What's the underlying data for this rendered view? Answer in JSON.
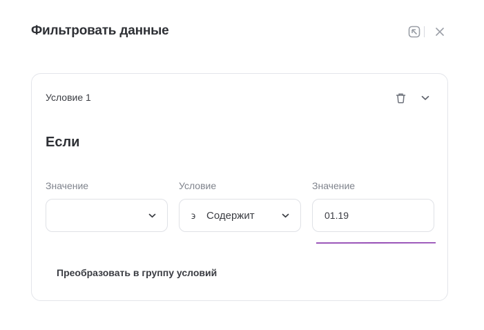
{
  "dialog": {
    "title": "Фильтровать данные",
    "actions": [
      "open-external-icon",
      "close-icon"
    ]
  },
  "condition": {
    "title": "Условие 1",
    "if_label": "Если",
    "fields": [
      {
        "label": "Значение",
        "value": ""
      },
      {
        "label": "Условие",
        "operator_symbol": "϶",
        "operator": "Содержит"
      },
      {
        "label": "Значение",
        "value": "01.19"
      }
    ],
    "convert_label": "Преобразовать в группу условий"
  },
  "colors": {
    "accent_underline": "#7a1fa2",
    "border": "#e3e5ea",
    "icon": "#8a8e97"
  }
}
